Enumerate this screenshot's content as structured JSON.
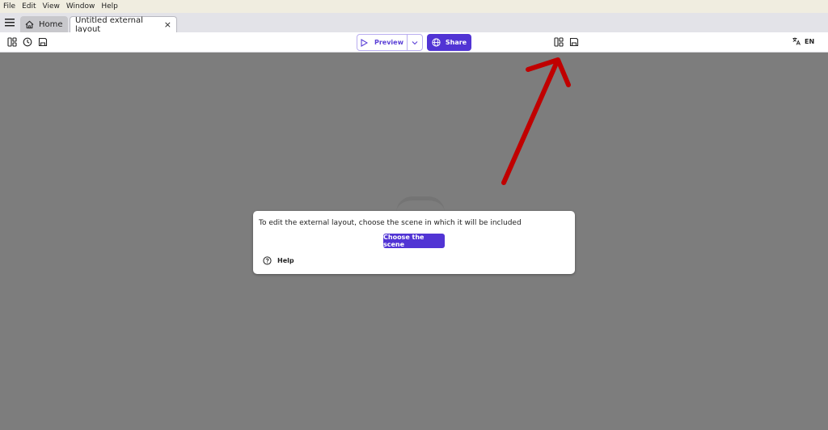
{
  "menubar": {
    "items": [
      "File",
      "Edit",
      "View",
      "Window",
      "Help"
    ]
  },
  "tabs": {
    "home": "Home",
    "active": "Untitled external layout",
    "close": "×"
  },
  "toolbar": {
    "preview_label": "Preview",
    "share_label": "Share",
    "language": "EN"
  },
  "dialog": {
    "message": "To edit the external layout, choose the scene in which it will be included",
    "choose_label": "Choose the scene",
    "help_label": "Help"
  },
  "colors": {
    "accent": "#5134d4",
    "canvas": "#7d7d7d",
    "annotation_arrow": "#c00000"
  },
  "icons": [
    "menu-icon",
    "home-icon",
    "close-icon",
    "panels-icon",
    "history-icon",
    "save-icon",
    "play-icon",
    "chevron-down-icon",
    "globe-icon",
    "translate-icon",
    "help-circle-icon"
  ]
}
